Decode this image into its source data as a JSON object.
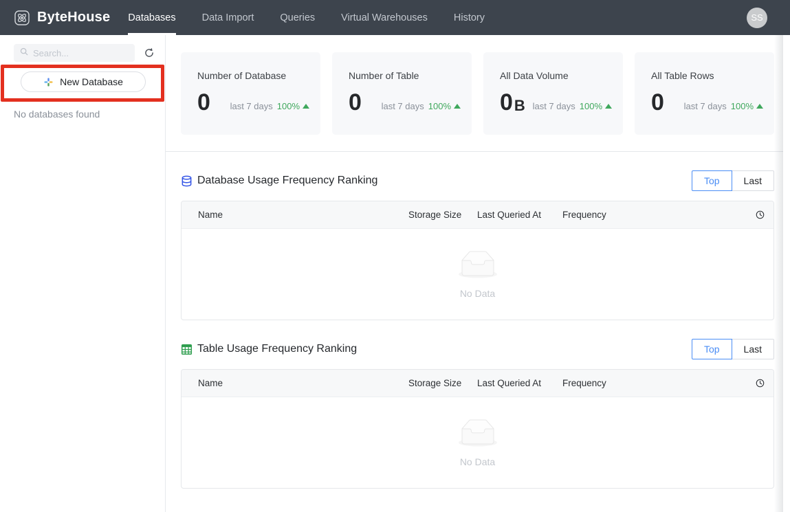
{
  "nav": {
    "brand": "ByteHouse",
    "items": [
      {
        "label": "Databases"
      },
      {
        "label": "Data Import"
      },
      {
        "label": "Queries"
      },
      {
        "label": "Virtual Warehouses"
      },
      {
        "label": "History"
      }
    ],
    "avatar_initials": "SS"
  },
  "sidebar": {
    "search_placeholder": "Search...",
    "new_database_button": "New Database",
    "empty_message": "No databases found"
  },
  "stat_cards": [
    {
      "title": "Number of Database",
      "value": "0",
      "unit": "",
      "period": "last 7 days",
      "change": "100%"
    },
    {
      "title": "Number of Table",
      "value": "0",
      "unit": "",
      "period": "last 7 days",
      "change": "100%"
    },
    {
      "title": "All Data Volume",
      "value": "0",
      "unit": "B",
      "period": "last 7 days",
      "change": "100%"
    },
    {
      "title": "All Table Rows",
      "value": "0",
      "unit": "",
      "period": "last 7 days",
      "change": "100%"
    }
  ],
  "sections": [
    {
      "title": "Database Usage Frequency Ranking",
      "toggle": {
        "top": "Top",
        "last": "Last",
        "active": "Top"
      },
      "table": {
        "columns": [
          "Name",
          "Storage Size",
          "Last Queried At",
          "Frequency"
        ],
        "rows": [],
        "empty_text": "No Data"
      }
    },
    {
      "title": "Table Usage Frequency Ranking",
      "toggle": {
        "top": "Top",
        "last": "Last",
        "active": "Top"
      },
      "table": {
        "columns": [
          "Name",
          "Storage Size",
          "Last Queried At",
          "Frequency"
        ],
        "rows": [],
        "empty_text": "No Data"
      }
    }
  ],
  "colors": {
    "navbar_bg": "#3d444d",
    "accent_blue": "#4a8df5",
    "positive_green": "#3fa85c",
    "annotation_red": "#e3301f"
  }
}
